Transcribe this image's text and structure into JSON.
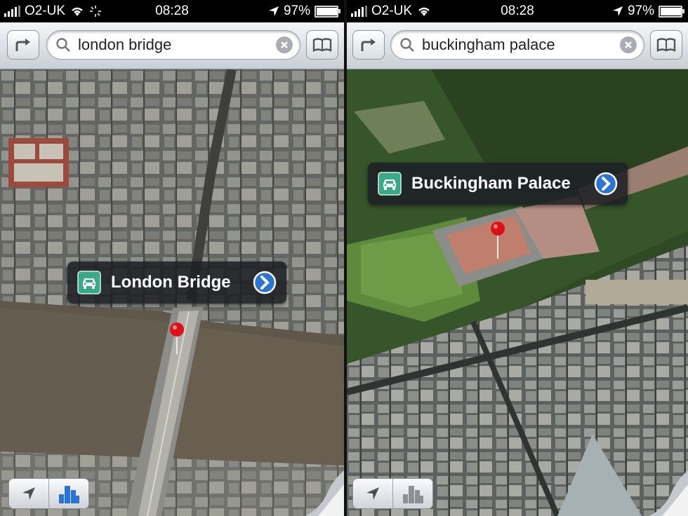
{
  "left": {
    "status": {
      "carrier": "O2-UK",
      "time": "08:28",
      "battery": "97%"
    },
    "search": {
      "value": "london bridge"
    },
    "callout": {
      "label": "London Bridge"
    }
  },
  "right": {
    "status": {
      "carrier": "O2-UK",
      "time": "08:28",
      "battery": "97%"
    },
    "search": {
      "value": "buckingham palace"
    },
    "callout": {
      "label": "Buckingham Palace"
    }
  },
  "battery_level": 0.97,
  "colors": {
    "accent_blue": "#2a74d6",
    "pin_red": "#e0101a",
    "callout_icon_green": "#3aa985"
  },
  "icons": [
    "directions-icon",
    "search-icon",
    "clear-icon",
    "bookmarks-icon",
    "car-icon",
    "disclosure-arrow-icon",
    "location-arrow-icon",
    "3d-buildings-icon",
    "page-curl-icon",
    "wifi-icon",
    "signal-bars-icon",
    "battery-icon"
  ]
}
